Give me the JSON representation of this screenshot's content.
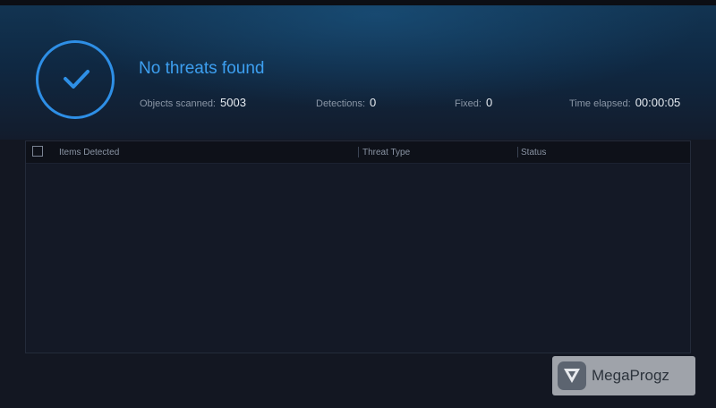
{
  "result": {
    "title": "No threats found",
    "icon": "checkmark-icon",
    "accent_color": "#2e8fe6"
  },
  "stats": {
    "objects_scanned": {
      "label": "Objects scanned:",
      "value": "5003"
    },
    "detections": {
      "label": "Detections:",
      "value": "0"
    },
    "fixed": {
      "label": "Fixed:",
      "value": "0"
    },
    "time_elapsed": {
      "label": "Time elapsed:",
      "value": "00:00:05"
    }
  },
  "table": {
    "columns": [
      "Items Detected",
      "Threat Type",
      "Status"
    ],
    "rows": []
  },
  "watermark": {
    "text": "MegaProgz",
    "icon": "megaprogz-logo-icon"
  }
}
